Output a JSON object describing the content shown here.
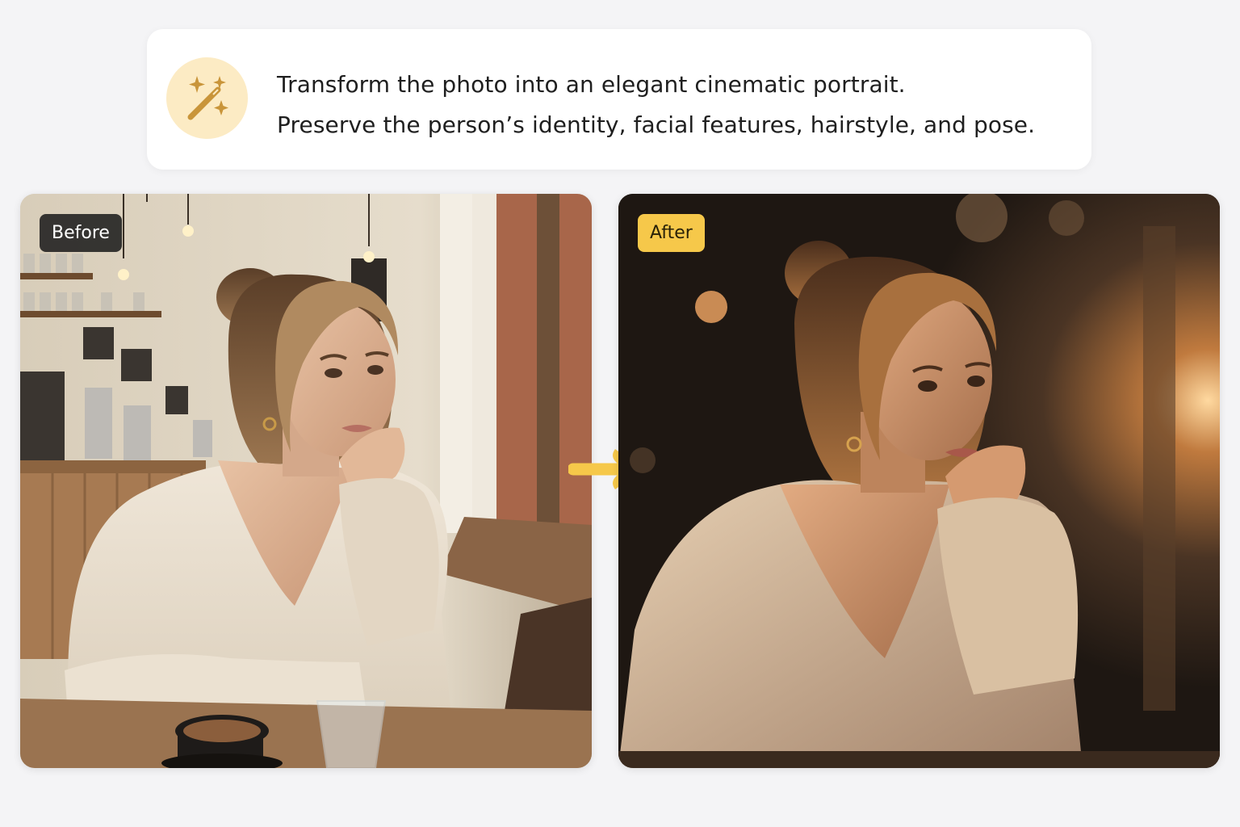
{
  "prompt": {
    "icon": "magic-wand-sparkles-icon",
    "line1": "Transform the photo into an elegant cinematic portrait.",
    "line2": "Preserve the person’s identity, facial features, hairstyle, and pose."
  },
  "before": {
    "badge": "Before"
  },
  "after": {
    "badge": "After"
  },
  "arrow": {
    "icon": "arrow-right-icon"
  },
  "colors": {
    "page_background": "#f4f4f6",
    "accent_yellow": "#f6c84a",
    "icon_circle": "#fcebc4",
    "icon_gold": "#c9953a",
    "badge_dark": "#1e1e1e"
  }
}
